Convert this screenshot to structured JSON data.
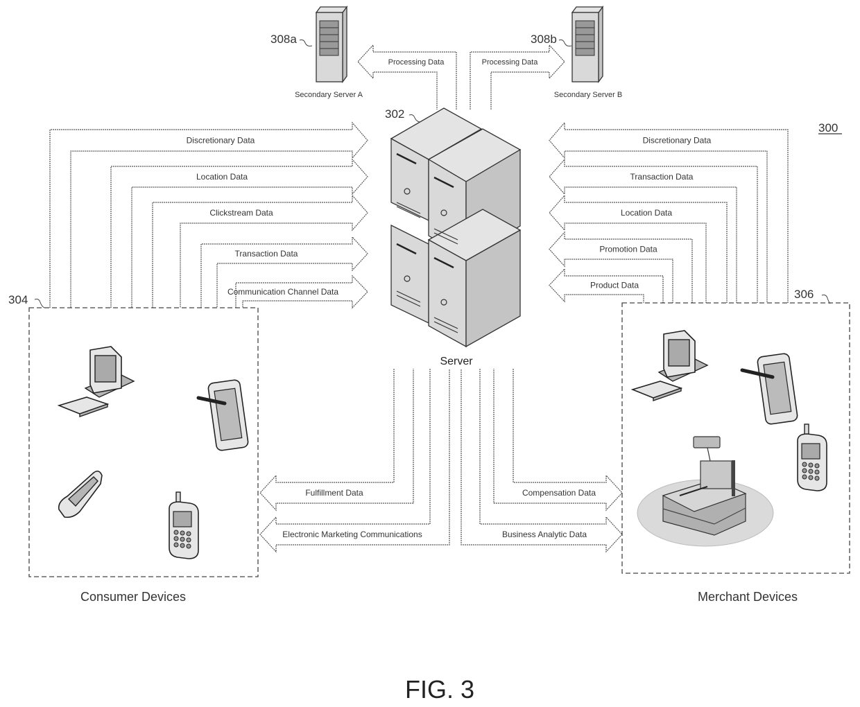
{
  "figure": {
    "caption": "FIG. 3",
    "system_ref": "300"
  },
  "server": {
    "ref": "302",
    "label": "Server"
  },
  "secondary_servers": [
    {
      "ref": "308a",
      "label": "Secondary Server A",
      "flow_label": "Processing Data"
    },
    {
      "ref": "308b",
      "label": "Secondary Server B",
      "flow_label": "Processing Data"
    }
  ],
  "consumer_devices": {
    "ref": "304",
    "label": "Consumer Devices",
    "devices": [
      "desktop-computer",
      "tablet-with-stylus",
      "flip-phone",
      "cell-phone"
    ],
    "to_server": [
      "Discretionary Data",
      "Location Data",
      "Clickstream Data",
      "Transaction Data",
      "Communication Channel Data"
    ],
    "from_server": [
      "Fulfillment Data",
      "Electronic Marketing Communications"
    ]
  },
  "merchant_devices": {
    "ref": "306",
    "label": "Merchant Devices",
    "devices": [
      "desktop-computer",
      "tablet-with-stylus",
      "cell-phone",
      "point-of-sale-register"
    ],
    "to_server": [
      "Discretionary Data",
      "Transaction Data",
      "Location Data",
      "Promotion Data",
      "Product Data"
    ],
    "from_server": [
      "Compensation Data",
      "Business Analytic Data"
    ]
  }
}
